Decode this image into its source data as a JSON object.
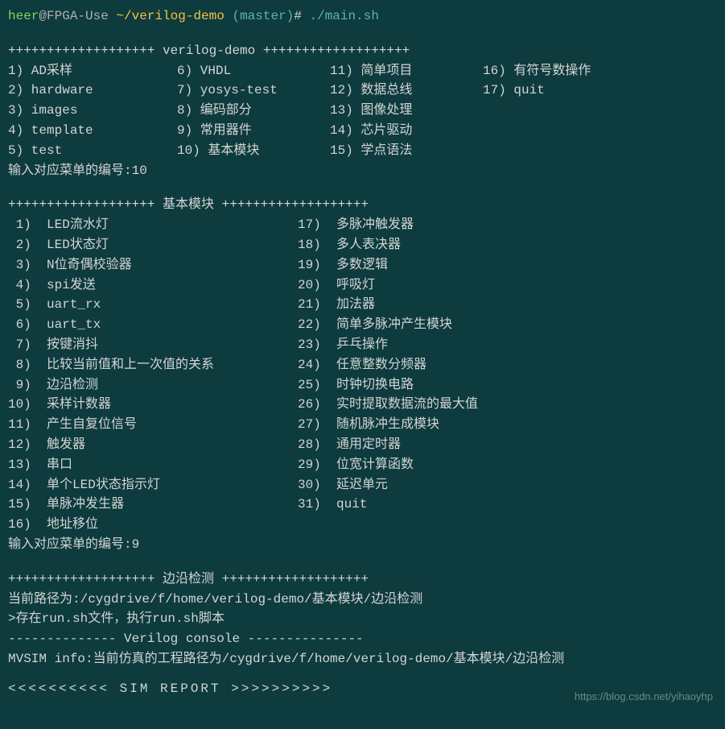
{
  "prompt": {
    "user": "heer",
    "host": "FPGA-Use",
    "path": "~/verilog-demo",
    "branch": "(master)",
    "symbol": "#",
    "command": "./main.sh"
  },
  "section1": {
    "header": "+++++++++++++++++++ verilog-demo +++++++++++++++++++",
    "items": [
      {
        "n": "1)",
        "t": "AD采样"
      },
      {
        "n": "6)",
        "t": "VHDL"
      },
      {
        "n": "11)",
        "t": "简单项目"
      },
      {
        "n": "16)",
        "t": "有符号数操作"
      },
      {
        "n": "2)",
        "t": "hardware"
      },
      {
        "n": "7)",
        "t": "yosys-test"
      },
      {
        "n": "12)",
        "t": "数据总线"
      },
      {
        "n": "17)",
        "t": "quit"
      },
      {
        "n": "3)",
        "t": "images"
      },
      {
        "n": "8)",
        "t": "编码部分"
      },
      {
        "n": "13)",
        "t": "图像处理"
      },
      {
        "n": "",
        "t": ""
      },
      {
        "n": "4)",
        "t": "template"
      },
      {
        "n": "9)",
        "t": "常用器件"
      },
      {
        "n": "14)",
        "t": "芯片驱动"
      },
      {
        "n": "",
        "t": ""
      },
      {
        "n": "5)",
        "t": "test"
      },
      {
        "n": "10)",
        "t": "基本模块"
      },
      {
        "n": "15)",
        "t": "学点语法"
      },
      {
        "n": "",
        "t": ""
      }
    ],
    "input_prompt": "输入对应菜单的编号:",
    "input_value": "10"
  },
  "section2": {
    "header": "+++++++++++++++++++ 基本模块 +++++++++++++++++++",
    "items": [
      {
        "n": " 1)",
        "t": "LED流水灯"
      },
      {
        "n": "17)",
        "t": "多脉冲触发器"
      },
      {
        "n": " 2)",
        "t": "LED状态灯"
      },
      {
        "n": "18)",
        "t": "多人表决器"
      },
      {
        "n": " 3)",
        "t": "N位奇偶校验器"
      },
      {
        "n": "19)",
        "t": "多数逻辑"
      },
      {
        "n": " 4)",
        "t": "spi发送"
      },
      {
        "n": "20)",
        "t": "呼吸灯"
      },
      {
        "n": " 5)",
        "t": "uart_rx"
      },
      {
        "n": "21)",
        "t": "加法器"
      },
      {
        "n": " 6)",
        "t": "uart_tx"
      },
      {
        "n": "22)",
        "t": "简单多脉冲产生模块"
      },
      {
        "n": " 7)",
        "t": "按键消抖"
      },
      {
        "n": "23)",
        "t": "乒乓操作"
      },
      {
        "n": " 8)",
        "t": "比较当前值和上一次值的关系"
      },
      {
        "n": "24)",
        "t": "任意整数分频器"
      },
      {
        "n": " 9)",
        "t": "边沿检测"
      },
      {
        "n": "25)",
        "t": "时钟切换电路"
      },
      {
        "n": "10)",
        "t": "采样计数器"
      },
      {
        "n": "26)",
        "t": "实时提取数据流的最大值"
      },
      {
        "n": "11)",
        "t": "产生自复位信号"
      },
      {
        "n": "27)",
        "t": "随机脉冲生成模块"
      },
      {
        "n": "12)",
        "t": "触发器"
      },
      {
        "n": "28)",
        "t": "通用定时器"
      },
      {
        "n": "13)",
        "t": "串口"
      },
      {
        "n": "29)",
        "t": "位宽计算函数"
      },
      {
        "n": "14)",
        "t": "单个LED状态指示灯"
      },
      {
        "n": "30)",
        "t": "延迟单元"
      },
      {
        "n": "15)",
        "t": "单脉冲发生器"
      },
      {
        "n": "31)",
        "t": "quit"
      },
      {
        "n": "16)",
        "t": "地址移位"
      },
      {
        "n": "",
        "t": ""
      }
    ],
    "input_prompt": "输入对应菜单的编号:",
    "input_value": "9"
  },
  "section3": {
    "header": "+++++++++++++++++++ 边沿检测 +++++++++++++++++++",
    "lines": [
      "当前路径为:/cygdrive/f/home/verilog-demo/基本模块/边沿检测",
      ">存在run.sh文件，执行run.sh脚本",
      "-------------- Verilog console ---------------",
      "MVSIM info:当前仿真的工程路径为/cygdrive/f/home/verilog-demo/基本模块/边沿检测"
    ]
  },
  "sim_report": "<<<<<<<<<< SIM REPORT >>>>>>>>>>",
  "watermark": "https://blog.csdn.net/yihaoyhp"
}
